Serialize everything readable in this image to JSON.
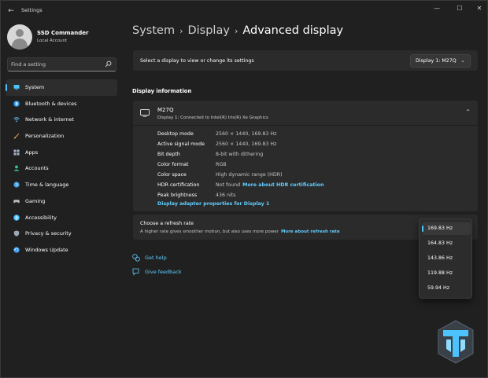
{
  "window": {
    "title": "Settings",
    "back_glyph": "←",
    "controls": [
      "—",
      "☐",
      "✕"
    ]
  },
  "user": {
    "name": "SSD Commander",
    "account": "Local Account"
  },
  "search": {
    "placeholder": "Find a setting",
    "icon": "search-icon"
  },
  "sidebar": {
    "items": [
      {
        "label": "System",
        "icon": "system-icon",
        "color": "#4cc2ff",
        "active": true
      },
      {
        "label": "Bluetooth & devices",
        "icon": "bluetooth-icon",
        "color": "#2f9cf0"
      },
      {
        "label": "Network & internet",
        "icon": "wifi-icon",
        "color": "#5fb3f0"
      },
      {
        "label": "Personalization",
        "icon": "brush-icon",
        "color": "#e8a15a"
      },
      {
        "label": "Apps",
        "icon": "apps-icon",
        "color": "#a3b3c8"
      },
      {
        "label": "Accounts",
        "icon": "person-icon",
        "color": "#3fc48b"
      },
      {
        "label": "Time & language",
        "icon": "globe-clock-icon",
        "color": "#4aa8e8"
      },
      {
        "label": "Gaming",
        "icon": "gamepad-icon",
        "color": "#b9b9b9"
      },
      {
        "label": "Accessibility",
        "icon": "accessibility-icon",
        "color": "#4cc2ff"
      },
      {
        "label": "Privacy & security",
        "icon": "shield-icon",
        "color": "#9aa8b8"
      },
      {
        "label": "Windows Update",
        "icon": "update-icon",
        "color": "#2f8fe8"
      }
    ]
  },
  "breadcrumb": {
    "items": [
      "System",
      "Display",
      "Advanced display"
    ],
    "separator": "›"
  },
  "display_select": {
    "prompt": "Select a display to view or change its settings",
    "value": "Display 1: M27Q",
    "chevron": "⌄"
  },
  "display_info": {
    "section_title": "Display information",
    "monitor_name": "M27Q",
    "monitor_sub": "Display 1: Connected to Intel(R) Iris(R) Xe Graphics",
    "collapse_glyph": "⌃",
    "rows": [
      {
        "key": "Desktop mode",
        "value": "2560 × 1440, 169.83 Hz",
        "link": ""
      },
      {
        "key": "Active signal mode",
        "value": "2560 × 1440, 169.83 Hz",
        "link": ""
      },
      {
        "key": "Bit depth",
        "value": "8-bit with dithering",
        "link": ""
      },
      {
        "key": "Color format",
        "value": "RGB",
        "link": ""
      },
      {
        "key": "Color space",
        "value": "High dynamic range (HDR)",
        "link": ""
      },
      {
        "key": "HDR certification",
        "value": "Not found",
        "link": "More about HDR certification"
      },
      {
        "key": "Peak brightness",
        "value": "436 nits",
        "link": ""
      }
    ],
    "adapter_link": "Display adapter properties for Display 1"
  },
  "refresh": {
    "title": "Choose a refresh rate",
    "subtitle": "A higher rate gives smoother motion, but also uses more power",
    "link": "More about refresh rate",
    "options": [
      "169.83 Hz",
      "164.83 Hz",
      "143.86 Hz",
      "119.88 Hz",
      "59.94 Hz"
    ],
    "selected": "169.83 Hz"
  },
  "help": {
    "get_help": "Get help",
    "give_feedback": "Give feedback"
  },
  "colors": {
    "accent": "#4cc2ff",
    "link": "#60cdff",
    "background": "#202020",
    "card": "#2b2b2b"
  }
}
